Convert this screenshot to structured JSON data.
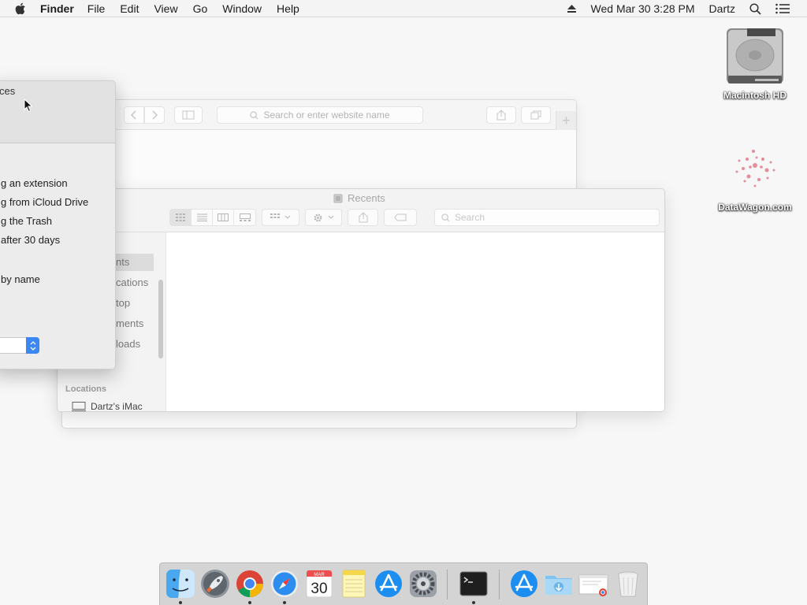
{
  "menubar": {
    "app_name": "Finder",
    "menus": [
      "File",
      "Edit",
      "View",
      "Go",
      "Window",
      "Help"
    ],
    "clock": "Wed Mar 30  3:28 PM",
    "user": "Dartz"
  },
  "desktop": {
    "icons": [
      {
        "label": "Macintosh HD",
        "icon": "hard-drive-icon"
      },
      {
        "label": "DataWagon.com",
        "icon": "image-file-icon"
      }
    ]
  },
  "safari": {
    "address_placeholder": "Search or enter website name",
    "new_tab": "+"
  },
  "finder": {
    "title": "Recents",
    "search_placeholder": "Search",
    "sidebar": {
      "favorites": [
        "nts",
        "cations",
        "top",
        "ments",
        "loads"
      ],
      "locations_header": "Locations",
      "locations": [
        "Dartz's iMac"
      ]
    }
  },
  "preferences": {
    "title": "ces",
    "options": [
      "g an extension",
      "g from iCloud Drive",
      "g the Trash",
      " after 30 days",
      "by name"
    ]
  },
  "dock": {
    "calendar_month": "MAR",
    "calendar_day": "30",
    "apps": [
      "Finder",
      "Launchpad",
      "Google Chrome",
      "Safari",
      "Calendar",
      "Notes",
      "App Store",
      "System Preferences",
      "Terminal"
    ],
    "others": [
      "Applications",
      "Downloads",
      "Window Preview",
      "Trash"
    ]
  },
  "colors": {
    "accent": "#3a87f5",
    "desktop": "#f7f7f7"
  }
}
